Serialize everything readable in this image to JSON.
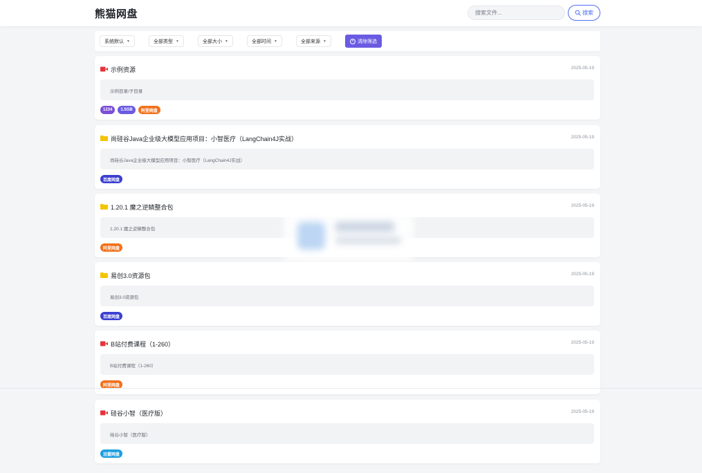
{
  "header": {
    "brand": "熊猫网盘",
    "search_placeholder": "搜索文件...",
    "search_button": "搜索"
  },
  "filters": {
    "items": [
      "系统默认",
      "全部类型",
      "全部大小",
      "全部时间",
      "全部来源"
    ],
    "clear_label": "清除筛选"
  },
  "colors": {
    "accent": "#4e6ef2",
    "purple_tag": "#7b4fd6",
    "violet_tag": "#6a5be2",
    "orange_tag": "#f2711c",
    "blue_tag": "#3b5bdb",
    "teal_tag": "#1c9ee0",
    "folder_icon": "#f5c400",
    "video_icon": "#e5343b"
  },
  "results": [
    {
      "icon": "video-icon",
      "title": "示例资源",
      "date": "2025-05-19",
      "path": "示例目录/子目录",
      "tags": [
        {
          "label": "1234",
          "color": "#7b4fd6"
        },
        {
          "label": "1.5GB",
          "color": "#6a5be2"
        },
        {
          "label": "阿里网盘",
          "color": "#f2711c"
        }
      ]
    },
    {
      "icon": "folder-icon",
      "title": "尚硅谷Java企业级大模型应用项目：小智医疗（LangChain4J实战）",
      "date": "2025-05-19",
      "path": "尚硅谷Java企业级大模型应用项目：小智医疗（LangChain4J实战）",
      "tags": [
        {
          "label": "百度网盘",
          "color": "#3b3fd1"
        }
      ]
    },
    {
      "icon": "folder-icon",
      "title": "1.20.1 魔之逆鳞整合包",
      "date": "2025-05-19",
      "path": "1.20.1 魔之逆鳞整合包",
      "tags": [
        {
          "label": "阿里网盘",
          "color": "#f2711c"
        }
      ]
    },
    {
      "icon": "folder-icon",
      "title": "易创3.0资源包",
      "date": "2025-05-19",
      "path": "易创3.0资源包",
      "tags": [
        {
          "label": "百度网盘",
          "color": "#3b3fd1"
        }
      ]
    },
    {
      "icon": "video-icon",
      "title": "B站付费课程（1-260）",
      "date": "2025-05-19",
      "path": "B站付费课程（1-260）",
      "tags": [
        {
          "label": "阿里网盘",
          "color": "#f2711c"
        }
      ]
    },
    {
      "icon": "video-icon",
      "title": "硅谷小智（医疗版）",
      "date": "2025-05-19",
      "path": "硅谷小智（医疗版）",
      "tags": [
        {
          "label": "迅雷网盘",
          "color": "#1c9ee0"
        }
      ]
    }
  ]
}
